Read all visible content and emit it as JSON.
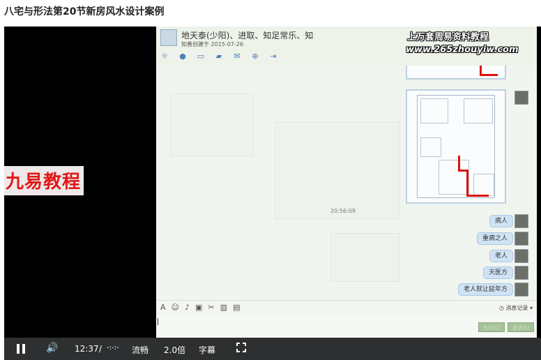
{
  "page": {
    "title": "八宅与形法第20节新房风水设计案例"
  },
  "overlay": {
    "brand": "九易教程"
  },
  "chat": {
    "title": "地天泰(少阳)、进取、知足常乐、知",
    "subtitle": "知善创建于 2015-07-26",
    "watermark_line1": "上万套周易资料教程",
    "watermark_line2": "www.265zhouyiw.com",
    "timestamp": "20:56:09",
    "messages": [
      "病人",
      "重病之人",
      "老人",
      "天医方",
      "老人就让延年方"
    ],
    "input_toolbar": {
      "message_record": "消息记录"
    },
    "send_buttons": [
      "关闭(C)",
      "发送(S)"
    ]
  },
  "player": {
    "current_time": "12:37",
    "separator": "/",
    "duration": "-:-:-",
    "quality": "流畅",
    "speed": "2.0倍",
    "subtitles": "字幕"
  }
}
